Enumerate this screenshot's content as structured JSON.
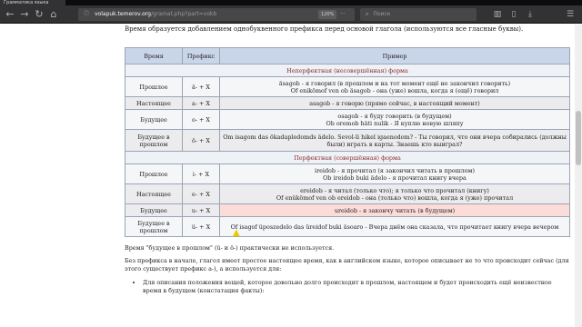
{
  "browser": {
    "tab_title": "Грамматика языка",
    "url_host": "volapuk.temerov.org",
    "url_path": "/gramat.php?part=vokb",
    "zoom": "120%",
    "search_placeholder": "Поиск"
  },
  "page": {
    "intro": "Время образуется добавлением однобуквенного префикса перед основой глагола (используются все гласные буквы).",
    "table": {
      "headers": [
        "Время",
        "Префикс",
        "Пример"
      ],
      "sections": [
        {
          "title": "Неперфектная (несовершённая) форма",
          "rows": [
            {
              "time": "Прошлое",
              "prefix": "ä- + X",
              "lines": [
                "äsagob - я говорил (в прошлом и на тот момент ещё не закончил говорить)",
                "Of enikömof ven ob äsagob - она (уже) вошла, когда я (ещё) говорил"
              ]
            },
            {
              "time": "Настоящее",
              "prefix": "a- + X",
              "lines": [
                "asagob - я говорю (прямо сейчас, в настоящий момент)"
              ]
            },
            {
              "time": "Будущее",
              "prefix": "o- + X",
              "lines": [
                "osagob - я буду говорить (в будущем)",
                "Ob oremob häti nulik - Я куплю новую шляпу"
              ]
            },
            {
              "time": "Будущее в прошлом",
              "prefix": "ö- + X",
              "lines": [
                "Om isagom das ökadapledomds ädelo. Sevol-li hikel igaenodom? - Ты говорил, что они вчера собирались (должны были) играть в карты. Знаешь кто выиграл?"
              ]
            }
          ]
        },
        {
          "title": "Перфектная (совершённая) форма",
          "rows": [
            {
              "time": "Прошлое",
              "prefix": "i- + X",
              "lines": [
                "ireidob - я прочитал (я закончил читать в прошлом)",
                "Ob ireidob buki ädelo - я прочитал книгу вчера"
              ]
            },
            {
              "time": "Настоящее",
              "prefix": "e- + X",
              "lines": [
                "ereidob - я читал (только что); я только что прочитал (книгу)",
                "Of enükömof ven ob ereidob - она (только что) вошла, когда я (уже) прочитал"
              ]
            },
            {
              "time": "Будущее",
              "prefix": "u- + X",
              "lines": [
                "ureidob - я закончу читать (в будущем)"
              ]
            },
            {
              "time": "Будущее в прошлом",
              "prefix": "ü- + X",
              "lines": [
                "Of isagof üposzedelo das üreidof buki äsoaro - Вчера днём она сказала, что прочитает книгу вчера вечером"
              ]
            }
          ]
        }
      ]
    },
    "note": "Время \"будущее в прошлом\" (ü- и ö-) практически не используется.",
    "paragraph": "Без префикса в начале, глагол имеет простое настоящее время, как в английском языке, которое описывает не то что происходит сейчас (для этого существует префикс a-), а используется для:",
    "bullet": "Для описания положения вещей, которое довольно долго происходит в прошлом, настоящем и будет происходить ещё неизвестное время в будущем (констатация факты):"
  },
  "colors": {
    "header_bg": "#c9d6ea",
    "section_text": "#8a2d2d",
    "highlight_row": "#fcdcd8"
  }
}
